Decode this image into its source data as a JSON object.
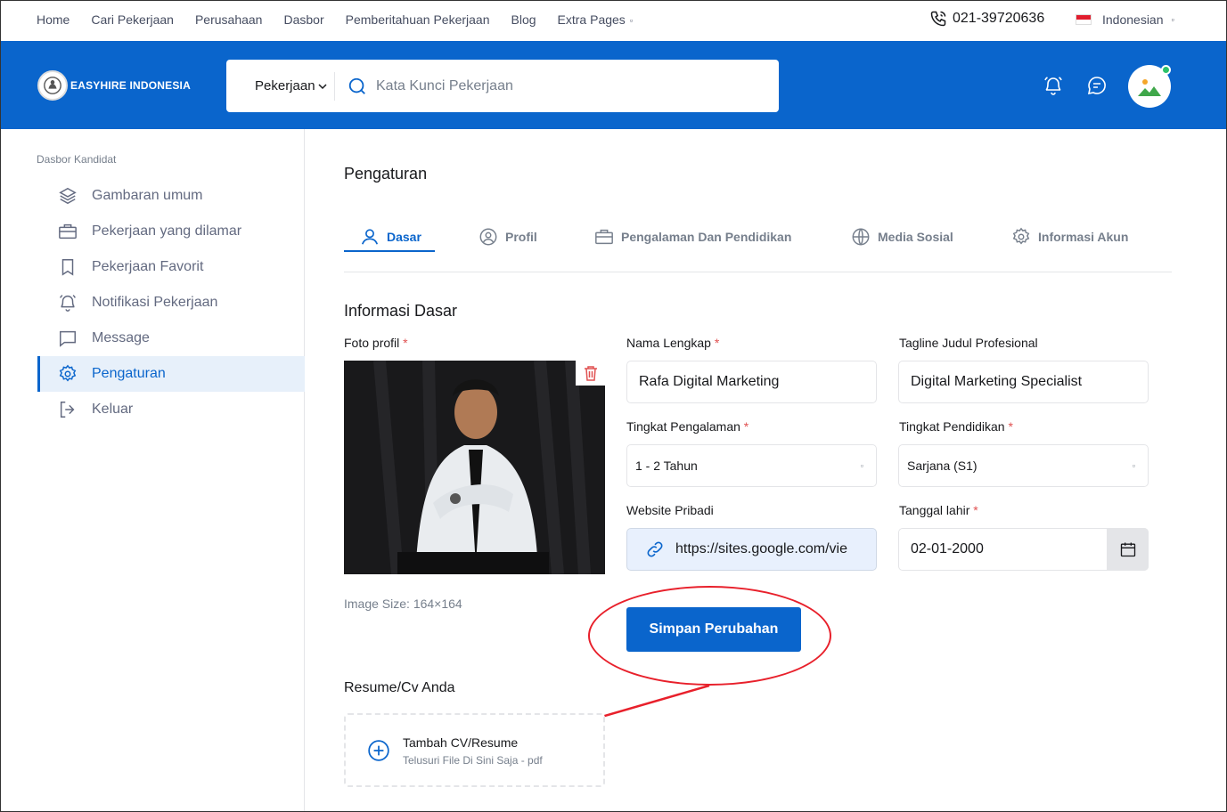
{
  "topbar": {
    "nav": [
      "Home",
      "Cari Pekerjaan",
      "Perusahaan",
      "Dasbor",
      "Pemberitahuan Pekerjaan",
      "Blog",
      "Extra Pages"
    ],
    "phone": "021-39720636",
    "language": "Indonesian"
  },
  "header": {
    "logo_text": "EASYHIRE INDONESIA",
    "search_category": "Pekerjaan",
    "search_placeholder": "Kata Kunci Pekerjaan"
  },
  "sidebar": {
    "title": "Dasbor Kandidat",
    "items": [
      {
        "label": "Gambaran umum",
        "icon": "layers-icon"
      },
      {
        "label": "Pekerjaan yang dilamar",
        "icon": "briefcase-icon"
      },
      {
        "label": "Pekerjaan Favorit",
        "icon": "bookmark-icon"
      },
      {
        "label": "Notifikasi Pekerjaan",
        "icon": "bell-icon"
      },
      {
        "label": "Message",
        "icon": "message-icon"
      },
      {
        "label": "Pengaturan",
        "icon": "gear-icon",
        "active": true
      },
      {
        "label": "Keluar",
        "icon": "logout-icon"
      }
    ]
  },
  "main": {
    "title": "Pengaturan",
    "tabs": [
      {
        "label": "Dasar",
        "icon": "user-icon",
        "active": true
      },
      {
        "label": "Profil",
        "icon": "user-circle-icon"
      },
      {
        "label": "Pengalaman Dan Pendidikan",
        "icon": "briefcase-icon"
      },
      {
        "label": "Media Sosial",
        "icon": "globe-icon"
      },
      {
        "label": "Informasi Akun",
        "icon": "gear-icon"
      }
    ],
    "section_title": "Informasi Dasar",
    "photo_label": "Foto profil",
    "image_size": "Image Size: 164×164",
    "fields": {
      "full_name_label": "Nama Lengkap",
      "full_name_value": "Rafa Digital Marketing",
      "tagline_label": "Tagline Judul Profesional",
      "tagline_value": "Digital Marketing Specialist",
      "experience_label": "Tingkat Pengalaman",
      "experience_value": "1 - 2 Tahun",
      "education_label": "Tingkat Pendidikan",
      "education_value": "Sarjana (S1)",
      "website_label": "Website Pribadi",
      "website_value": "https://sites.google.com/vie",
      "birthdate_label": "Tanggal lahir",
      "birthdate_value": "02-01-2000"
    },
    "required_mark": "*",
    "save_button": "Simpan Perubahan",
    "resume_title": "Resume/Cv Anda",
    "resume_add": "Tambah CV/Resume",
    "resume_hint": "Telusuri File Di Sini Saja - pdf"
  },
  "colors": {
    "primary": "#0a65cc",
    "annotation": "#e8202b",
    "online": "#2dc26b"
  }
}
